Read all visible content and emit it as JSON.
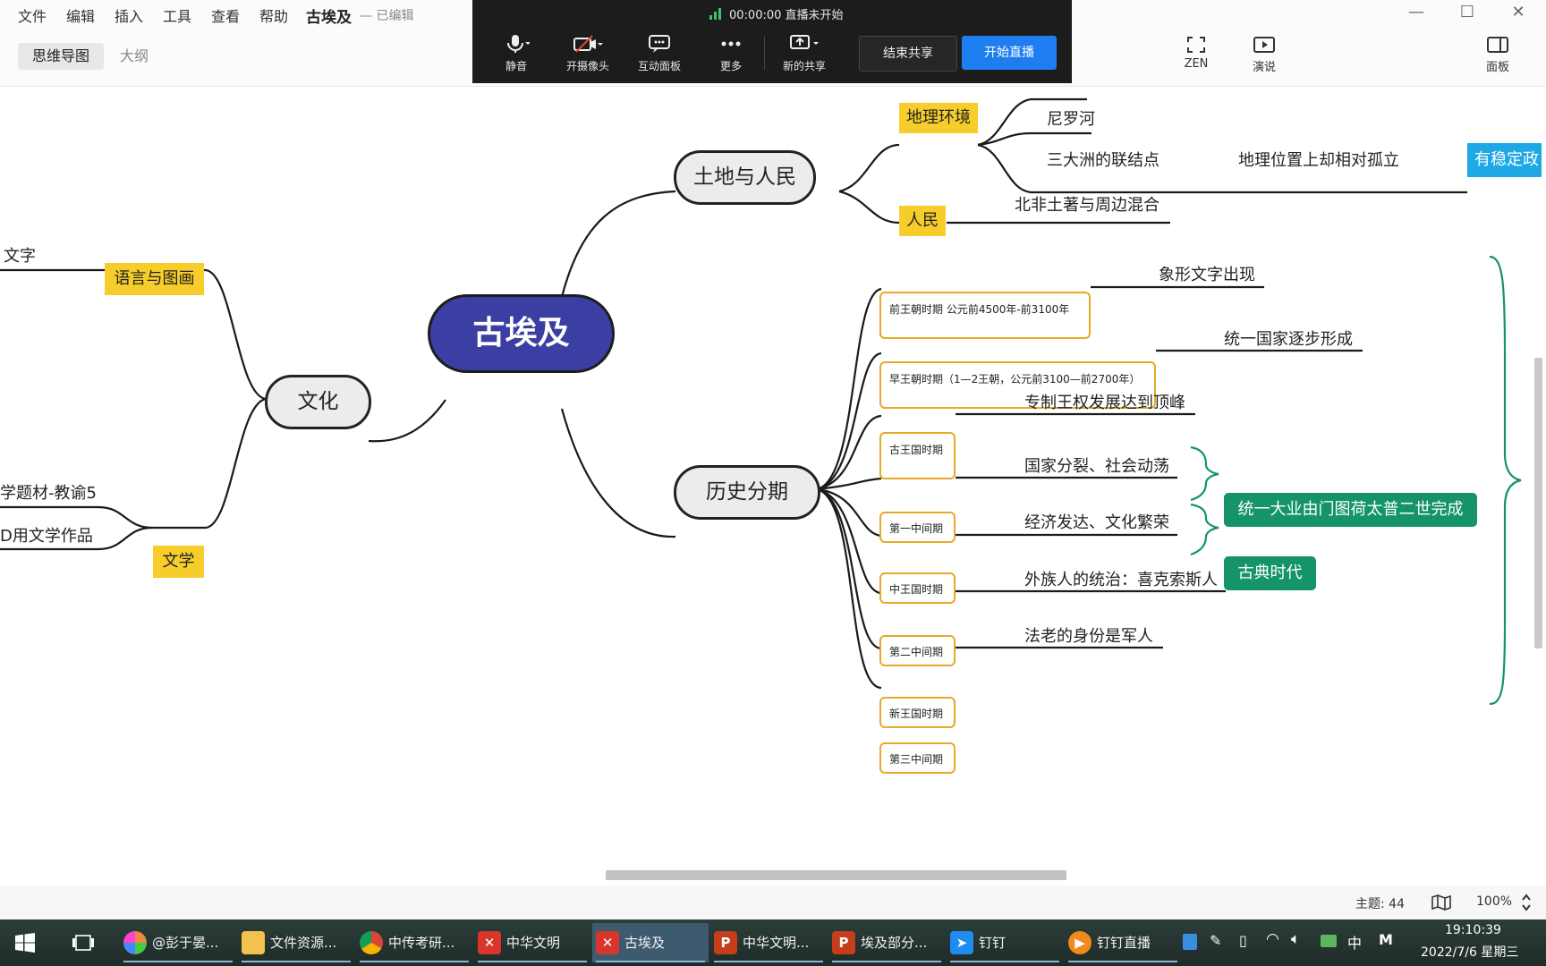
{
  "menubar": {
    "items": [
      "文件",
      "编辑",
      "插入",
      "工具",
      "查看",
      "帮助"
    ],
    "doc_title": "古埃及",
    "doc_status": "— 已编辑"
  },
  "view_tabs": {
    "mindmap": "思维导图",
    "outline": "大纲"
  },
  "right_tools": {
    "zen": "ZEN",
    "present": "演说",
    "panel": "面板"
  },
  "live_toolbar": {
    "timer": "00:00:00",
    "status": "直播未开始",
    "mute": "静音",
    "camera": "开摄像头",
    "interact": "互动面板",
    "more": "更多",
    "new_share": "新的共享",
    "end_share": "结束共享",
    "start_live": "开始直播"
  },
  "mindmap": {
    "root": "古埃及",
    "land_people": {
      "label": "土地与人民",
      "geo": {
        "label": "地理环境",
        "items": [
          "尼罗河",
          "三大洲的联结点"
        ],
        "isolation": "地理位置上却相对孤立",
        "stability": "有稳定政"
      },
      "people": {
        "label": "人民",
        "item": "北非土著与周边混合"
      }
    },
    "periods": {
      "label": "历史分期",
      "items": [
        {
          "label": "前王朝时期 公元前4500年-前3100年",
          "desc": "象形文字出现"
        },
        {
          "label": "早王朝时期（1—2王朝，公元前3100—前2700年）",
          "desc": "统一国家逐步形成"
        },
        {
          "label": "古王国时期",
          "desc": "专制王权发展达到顶峰"
        },
        {
          "label": "第一中间期",
          "desc": "国家分裂、社会动荡",
          "note": "统一大业由门图荷太普二世完成"
        },
        {
          "label": "中王国时期",
          "desc": "经济发达、文化繁荣",
          "note": "古典时代"
        },
        {
          "label": "第二中间期",
          "desc": "外族人的统治：喜克索斯人"
        },
        {
          "label": "新王国时期",
          "desc": "法老的身份是军人"
        },
        {
          "label": "第三中间期",
          "desc": ""
        }
      ]
    },
    "culture": {
      "label": "文化",
      "language": {
        "label": "语言与图画",
        "item": "文字"
      },
      "literature": {
        "label": "文学",
        "items": [
          "学题材-教谕5",
          "D用文学作品"
        ]
      }
    }
  },
  "status_bar": {
    "topics": "主题: 44",
    "zoom": "100%"
  },
  "taskbar": {
    "tasks": [
      "@彭于晏...",
      "文件资源...",
      "中传考研...",
      "中华文明",
      "古埃及",
      "中华文明...",
      "埃及部分...",
      "钉钉",
      "钉钉直播"
    ],
    "ime": "中",
    "time": "19:10:39",
    "date": "2022/7/6 星期三"
  },
  "colors": {
    "root_fill": "#3b3fa3",
    "yellow_tag": "#f6cd2a",
    "orange_border": "#e7a928",
    "green_tag": "#15936b",
    "blue_tag": "#1ea8e6",
    "live_primary": "#1e7ef0"
  }
}
